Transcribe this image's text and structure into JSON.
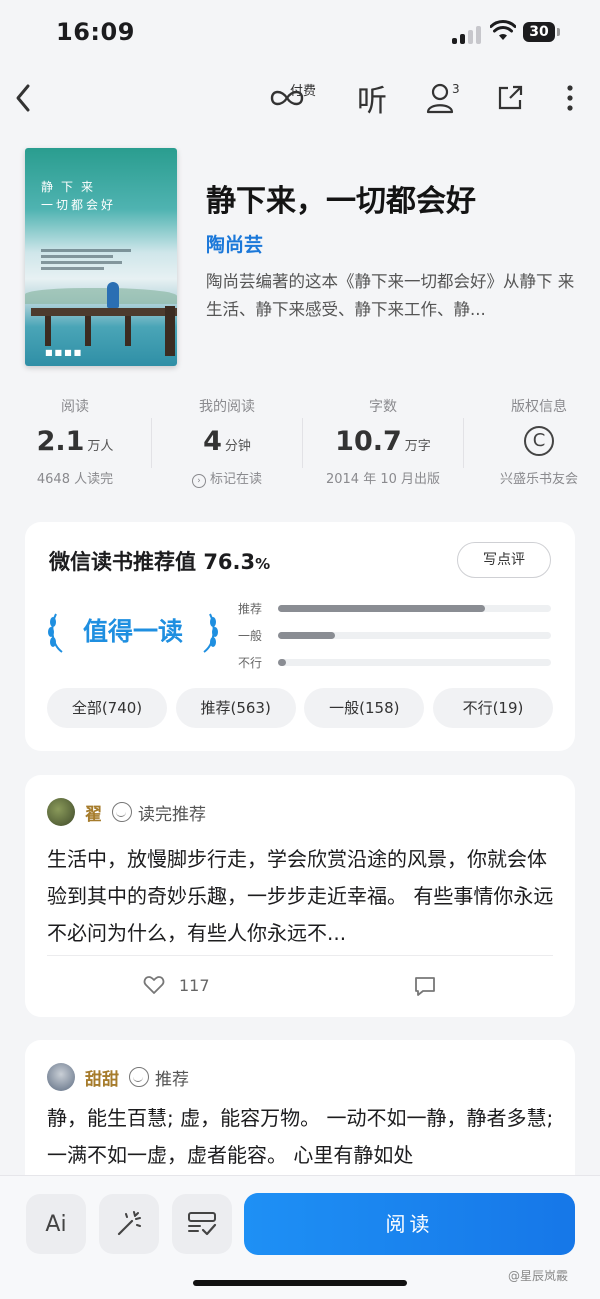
{
  "status_bar": {
    "time": "16:09",
    "battery": "30"
  },
  "nav": {
    "pay_label": "付费",
    "listen_label": "听",
    "friends_count": "3"
  },
  "book": {
    "title": "静下来，一切都会好",
    "author": "陶尚芸",
    "description": "陶尚芸编著的这本《静下来一切都会好》从静下 来生活、静下来感受、静下来工作、静...",
    "cover": {
      "title_line": "静下来",
      "subtitle_line": "一切都会好"
    }
  },
  "stats": [
    {
      "label": "阅读",
      "value": "2.1",
      "unit": "万人",
      "sub": "4648 人读完"
    },
    {
      "label": "我的阅读",
      "value": "4",
      "unit": "分钟",
      "sub": "标记在读"
    },
    {
      "label": "字数",
      "value": "10.7",
      "unit": "万字",
      "sub": "2014 年 10 月出版"
    },
    {
      "label": "版权信息",
      "symbol": "C",
      "sub": "兴盛乐书友会"
    }
  ],
  "recommend": {
    "title": "微信读书推荐值",
    "score": "76.3",
    "score_unit": "%",
    "review_button": "写点评",
    "badge": "值得一读",
    "bars": [
      {
        "label": "推荐",
        "fraction": 0.76
      },
      {
        "label": "一般",
        "fraction": 0.21
      },
      {
        "label": "不行",
        "fraction": 0.03
      }
    ],
    "filters": [
      "全部(740)",
      "推荐(563)",
      "一般(158)",
      "不行(19)"
    ]
  },
  "reviews": [
    {
      "name": "翟",
      "tag": "读完推荐",
      "text": "生活中，放慢脚步行走，学会欣赏沿途的风景，你就会体验到其中的奇妙乐趣，一步步走近幸福。 有些事情你永远不必问为什么，有些人你永远不...",
      "likes": "117"
    },
    {
      "name": "甜甜",
      "tag": "推荐",
      "text": "静，能生百慧; 虚，能容万物。 一动不如一静，静者多慧; 一满不如一虚，虚者能容。 心里有静如处"
    }
  ],
  "bottom": {
    "read_button": "阅读",
    "ai_label": "Ai"
  },
  "watermark": "@星辰岚霰",
  "colors": {
    "accent": "#1b78d9",
    "read_button": "#1e86f2",
    "badge": "#1f8fe0",
    "reviewer_name": "#a67c2c"
  }
}
